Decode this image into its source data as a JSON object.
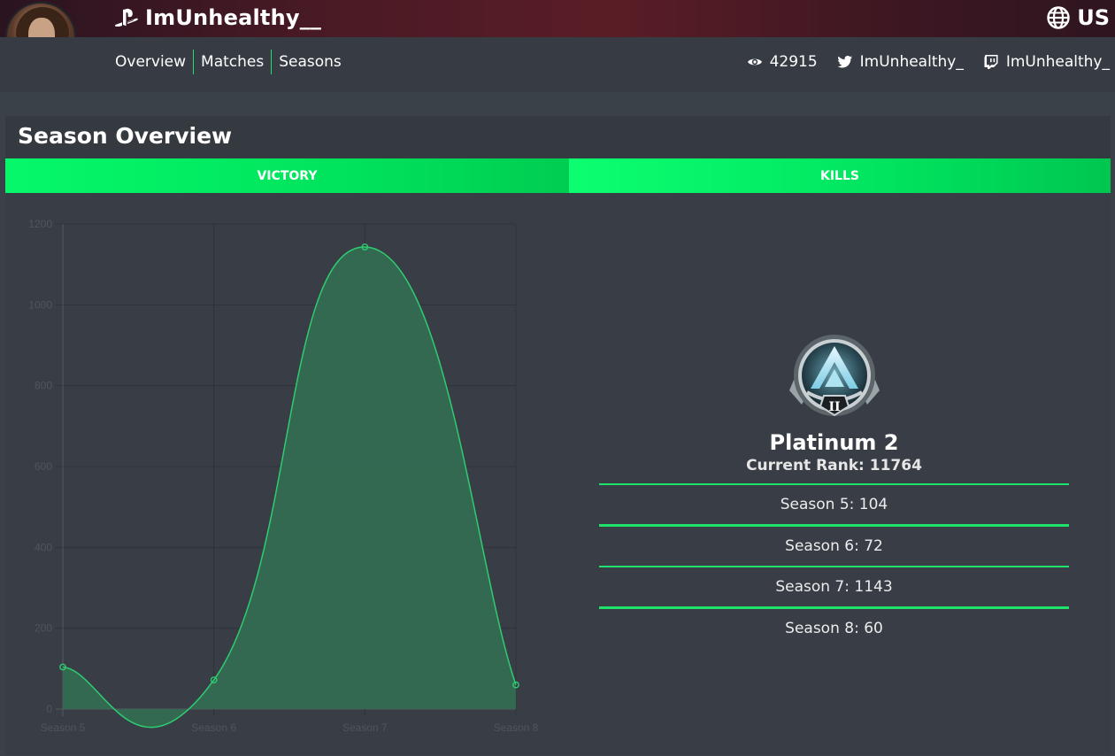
{
  "profile": {
    "username": "ImUnhealthy__",
    "region": "US"
  },
  "nav": {
    "items": [
      "Overview",
      "Matches",
      "Seasons"
    ]
  },
  "socials": {
    "views": "42915",
    "twitter": "ImUnhealthy_",
    "twitch": "ImUnhealthy_"
  },
  "card": {
    "title": "Season Overview",
    "tabs": [
      "VICTORY",
      "KILLS"
    ]
  },
  "rank": {
    "name": "Platinum 2",
    "current_label": "Current Rank: 11764",
    "badge_numeral": "II",
    "seasons": [
      "Season 5: 104",
      "Season 6: 72",
      "Season 7: 1143",
      "Season 8: 60"
    ]
  },
  "colors": {
    "accent": "#1ee36a",
    "line": "#2ecc71",
    "fill": "#336b52"
  },
  "chart_data": {
    "type": "area",
    "categories": [
      "Season 5",
      "Season 6",
      "Season 7",
      "Season 8"
    ],
    "values": [
      104,
      72,
      1143,
      60
    ],
    "ylim": [
      0,
      1200
    ],
    "yticks": [
      0,
      200,
      400,
      600,
      800,
      1000,
      1200
    ],
    "grid": true
  }
}
